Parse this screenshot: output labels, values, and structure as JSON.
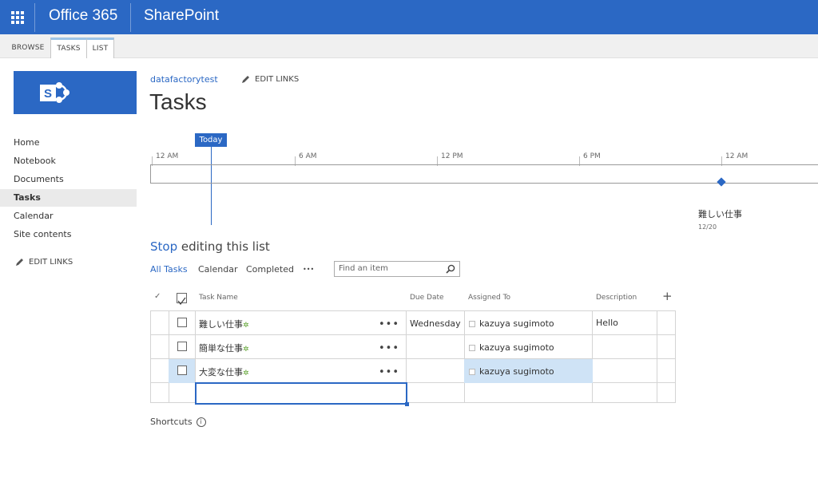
{
  "suite": {
    "app1": "Office 365",
    "app2": "SharePoint"
  },
  "ribbon": {
    "tabs": [
      "BROWSE",
      "TASKS",
      "LIST"
    ]
  },
  "nav": {
    "items": [
      "Home",
      "Notebook",
      "Documents",
      "Tasks",
      "Calendar",
      "Site contents"
    ],
    "selected": "Tasks",
    "edit_links": "EDIT LINKS"
  },
  "header": {
    "site": "datafactorytest",
    "edit_links": "EDIT LINKS",
    "title": "Tasks"
  },
  "timeline": {
    "today": "Today",
    "ticks": [
      "12 AM",
      "6 AM",
      "12 PM",
      "6 PM",
      "12 AM"
    ],
    "task_name": "難しい仕事",
    "task_date": "12/20"
  },
  "list": {
    "stop_word": "Stop",
    "stop_rest": " editing this list",
    "views": [
      "All Tasks",
      "Calendar",
      "Completed"
    ],
    "more": "•••",
    "search_placeholder": "Find an item",
    "columns": {
      "task_name": "Task Name",
      "due_date": "Due Date",
      "assigned_to": "Assigned To",
      "description": "Description",
      "add": "+"
    },
    "rows": [
      {
        "name": "難しい仕事",
        "due": "Wednesday",
        "assigned": "kazuya sugimoto",
        "description": "Hello"
      },
      {
        "name": "簡単な仕事",
        "due": "",
        "assigned": "kazuya sugimoto",
        "description": ""
      },
      {
        "name": "大変な仕事",
        "due": "",
        "assigned": "kazuya sugimoto",
        "description": ""
      }
    ],
    "row_more": "•••",
    "new_marker": "✲",
    "shortcuts": "Shortcuts",
    "info": "i"
  },
  "colors": {
    "brand": "#2b68c4",
    "selection": "#cfe3f6",
    "new_marker": "#5aa02c"
  }
}
